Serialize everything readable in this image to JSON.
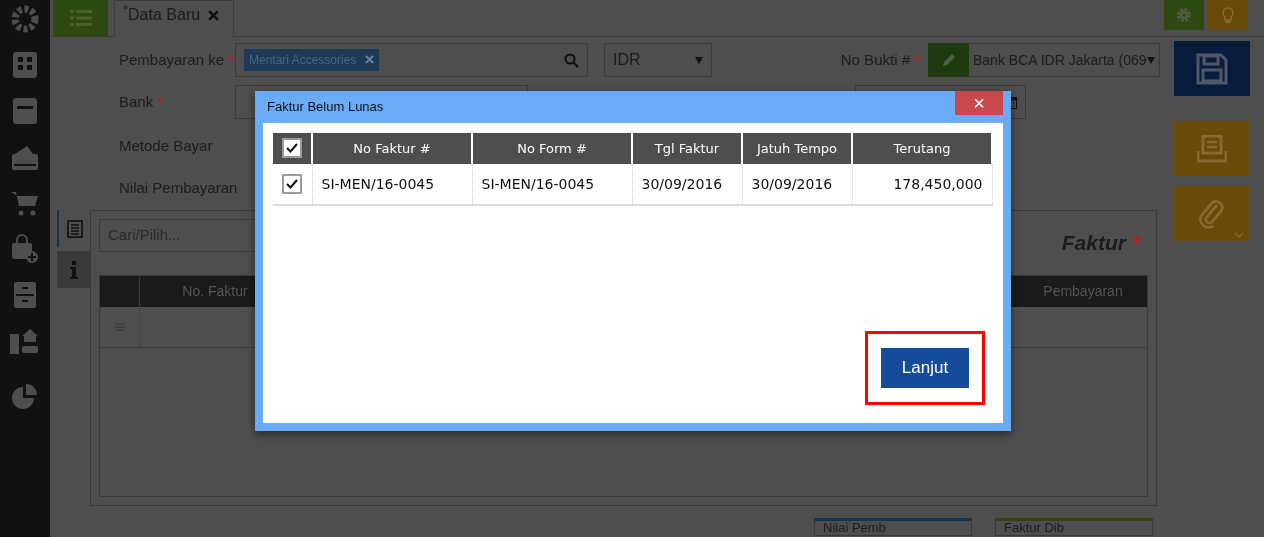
{
  "tab": {
    "unsaved_mark": "*",
    "label": "Data Baru"
  },
  "form": {
    "rows": [
      {
        "label": "Pembayaran ke",
        "required": true
      },
      {
        "label": "Bank",
        "required": true
      },
      {
        "label": "Metode Bayar",
        "required": false
      },
      {
        "label": "Nilai Pembayaran",
        "required": false
      }
    ],
    "payee_tag": {
      "label": "Mentari Accessories",
      "remove": "×"
    },
    "currency": "IDR",
    "proof_no": {
      "label": "No Bukti #",
      "required": true,
      "value": "Bank BCA IDR Jakarta (069"
    }
  },
  "panel": {
    "search_placeholder": "Cari/Pilih...",
    "title": "Faktur",
    "title_required": true,
    "columns": [
      "No. Faktur",
      "Pembayaran"
    ]
  },
  "summary_tabs": [
    "Nilai Pemb",
    "Faktur Dib"
  ],
  "modal": {
    "title": "Faktur Belum Lunas",
    "close": "×",
    "all_checked": true,
    "columns": [
      {
        "label": "No Faktur #",
        "numeric": false
      },
      {
        "label": "No Form #",
        "numeric": false
      },
      {
        "label": "Tgl Faktur",
        "numeric": false
      },
      {
        "label": "Jatuh Tempo",
        "numeric": false
      },
      {
        "label": "Terutang",
        "numeric": true
      }
    ],
    "rows": [
      {
        "checked": true,
        "cells": [
          "SI-MEN/16-0045",
          "SI-MEN/16-0045",
          "30/09/2016",
          "30/09/2016",
          "178,450,000"
        ]
      }
    ],
    "button": "Lanjut",
    "button_highlighted": true
  }
}
